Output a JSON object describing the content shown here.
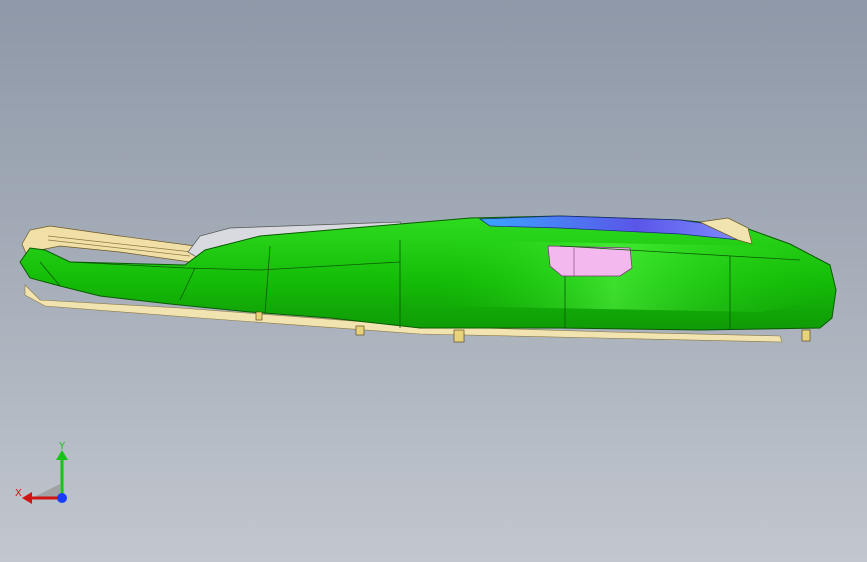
{
  "viewport": {
    "background_top": "#8f98a8",
    "background_bottom": "#c2c7ce"
  },
  "model": {
    "body_color": "#17c70a",
    "body_dark": "#0d8f07",
    "highlight_color": "#3df530",
    "tan_color": "#f2e4b0",
    "pink_color": "#f3b8ee",
    "blue_color": "#4f7dff",
    "gray_color": "#d6d8de"
  },
  "triad": {
    "x_label": "X",
    "y_label": "Y",
    "x_color": "#d01414",
    "y_color": "#18c218",
    "z_color": "#1a3cff"
  }
}
